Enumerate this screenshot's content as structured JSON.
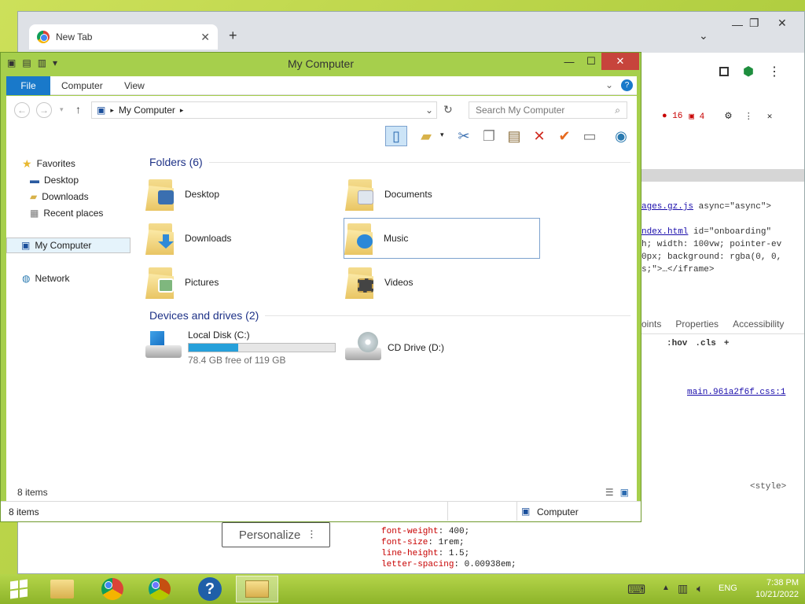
{
  "browser": {
    "tab_title": "New Tab",
    "devtools": {
      "error_count": "16",
      "warning_count": "4",
      "code_lines": [
        {
          "text": "ages.gz.js\" async=\"async\">",
          "link": "ages.gz.js"
        },
        {
          "text": "ndex.html\" id=\"onboarding\"",
          "link": "ndex.html"
        },
        {
          "text": "h; width: 100vw; pointer-ev"
        },
        {
          "text": "0px; background: rgba(0, 0,"
        },
        {
          "text": "s;\">…</iframe>"
        }
      ],
      "tabs": [
        "oints",
        "Properties",
        "Accessibility"
      ],
      "filter_hov": ":hov",
      "filter_cls": ".cls",
      "stylesheet_link": "main.961a2f6f.css:1",
      "style_tag": "<style>",
      "css_rules": [
        {
          "prop": "font-weight",
          "value": "400;"
        },
        {
          "prop": "font-size",
          "value": "1rem;"
        },
        {
          "prop": "line-height",
          "value": "1.5;"
        },
        {
          "prop": "letter-spacing",
          "value": "0.00938em;"
        }
      ]
    },
    "personalize_label": "Personalize"
  },
  "explorer": {
    "title": "My Computer",
    "ribbon_tabs": [
      "File",
      "Computer",
      "View"
    ],
    "address_path": "My Computer",
    "search_placeholder": "Search My Computer",
    "nav": {
      "favorites": "Favorites",
      "favorite_items": [
        "Desktop",
        "Downloads",
        "Recent places"
      ],
      "my_computer": "My Computer",
      "network": "Network"
    },
    "folders_header": "Folders (6)",
    "folders": [
      {
        "name": "Desktop",
        "icon": "desktop-folder-icon",
        "badge": "#3a6fb0"
      },
      {
        "name": "Documents",
        "icon": "documents-folder-icon",
        "badge": "#dfe6ee"
      },
      {
        "name": "Downloads",
        "icon": "downloads-folder-icon",
        "badge": "#2f8ad8"
      },
      {
        "name": "Music",
        "icon": "music-folder-icon",
        "badge": "#2b88d8"
      },
      {
        "name": "Pictures",
        "icon": "pictures-folder-icon",
        "badge": "#7fb77e"
      },
      {
        "name": "Videos",
        "icon": "videos-folder-icon",
        "badge": "#444444"
      }
    ],
    "drives_header": "Devices and drives (2)",
    "drives": [
      {
        "name": "Local Disk (C:)",
        "free": "78.4 GB free of 119 GB",
        "used_fraction": 0.341
      },
      {
        "name": "CD Drive (D:)"
      }
    ],
    "status_items": "8 items",
    "status_items_bottom": "8 items",
    "status_location": "Computer"
  },
  "taskbar": {
    "time": "7:38 PM",
    "date": "10/21/2022",
    "language": "ENG"
  }
}
